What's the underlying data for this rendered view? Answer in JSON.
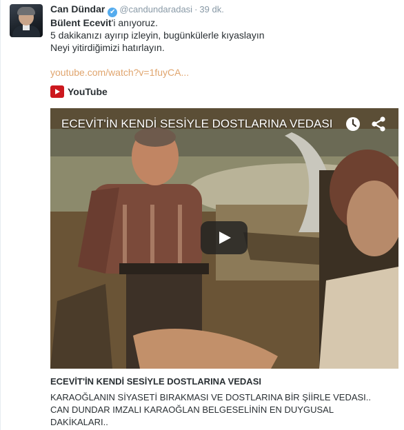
{
  "tweet": {
    "author_name": "Can Dündar",
    "handle": "@candundaradasi",
    "separator": "·",
    "time": "39 dk.",
    "verified_icon": "✔",
    "text_lines": [
      {
        "mention": "Bülent Ecevit",
        "rest": "'i anıyoruz."
      },
      "5 dakikanızı ayırıp izleyin, bugünkülerle kıyaslayın",
      "Neyi yitirdiğimizi hatırlayın."
    ],
    "link": "youtube.com/watch?v=1fuyCA..."
  },
  "card": {
    "provider": "YouTube",
    "video_title": "ECEVİT'İN KENDİ SESİYLE DOSTLARINA VEDASI",
    "title": "ECEVİT'İN KENDİ SESİYLE DOSTLARINA VEDASI",
    "description_lines": [
      "KARAOĞLANIN SİYASETİ BIRAKMASI VE DOSTLARINA BİR ŞİİRLE VEDASI..",
      "CAN DUNDAR IMZALI KARAOĞLAN BELGESELİNİN EN DUYGUSAL",
      "DAKİKALARI.."
    ]
  },
  "icons": {
    "avatar": "avatar-photo",
    "verified": "verified-badge-icon",
    "youtube": "youtube-logo-icon",
    "watch_later": "clock-icon",
    "share": "share-icon",
    "play": "play-icon"
  },
  "colors": {
    "link": "#e0a56e",
    "verified": "#55acee",
    "youtube_red": "#cc181e",
    "muted": "#8899a6",
    "text": "#292f33"
  }
}
